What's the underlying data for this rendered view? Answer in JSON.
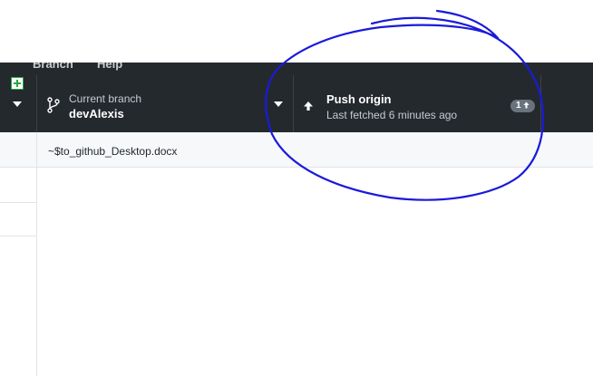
{
  "menu": {
    "branch": "Branch",
    "help": "Help"
  },
  "toolbar": {
    "current_branch_label": "Current branch",
    "current_branch_value": "devAlexis",
    "push_title": "Push origin",
    "push_subtitle": "Last fetched 6 minutes ago",
    "ahead_count": "1"
  },
  "file": {
    "path": "~$to_github_Desktop.docx"
  },
  "icons": {
    "branch": "git-branch-icon",
    "push": "arrow-up-icon",
    "added": "file-added-icon"
  },
  "colors": {
    "toolbar_bg": "#24292e",
    "annotation": "#1a1adb",
    "added_green": "#28a745"
  }
}
